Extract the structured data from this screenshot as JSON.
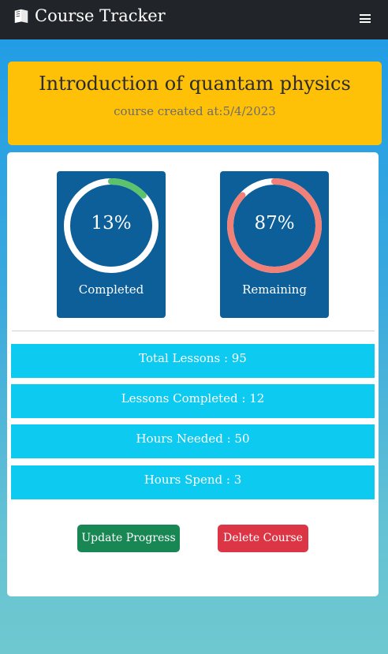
{
  "navbar": {
    "brand": "Course Tracker",
    "brand_icon": "book-icon",
    "menu_icon": "hamburger-menu-icon"
  },
  "course": {
    "title": "Introduction of quantam physics",
    "created": "course created at:5/4/2023"
  },
  "progress": {
    "completed_label": "Completed",
    "completed_value": "13%",
    "completed_fraction": 0.13,
    "remaining_label": "Remaining",
    "remaining_value": "87%",
    "remaining_fraction": 0.87
  },
  "stats": [
    "Total Lessons : 95",
    "Lessons Completed : 12",
    "Hours Needed : 50",
    "Hours Spend : 3"
  ],
  "actions": {
    "update_label": "Update Progress",
    "delete_label": "Delete Course"
  },
  "colors": {
    "navbar": "#212529",
    "header": "#ffc107",
    "stat_box": "#0d5f9a",
    "completed_ring": "#5cc26c",
    "remaining_ring": "#f08078",
    "info_row": "#0dcaf0",
    "update_button": "#198754",
    "delete_button": "#dc3545"
  }
}
